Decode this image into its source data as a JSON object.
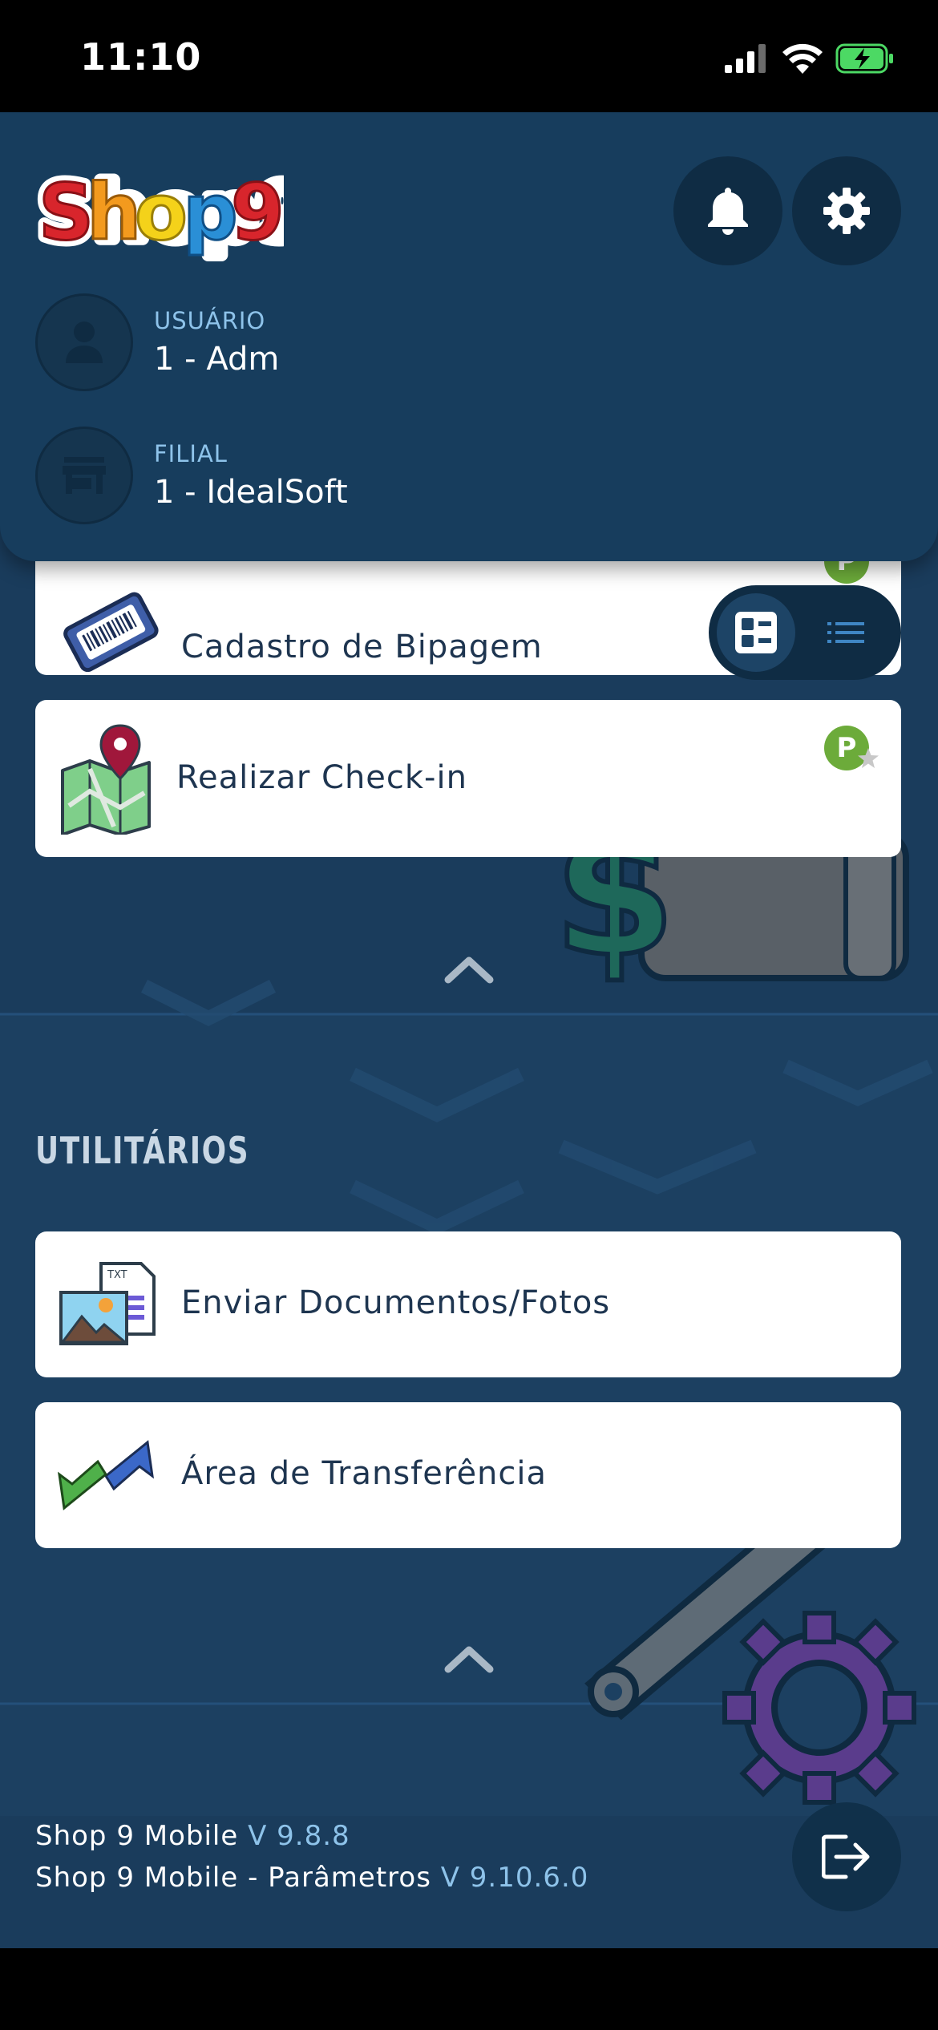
{
  "status_bar": {
    "time": "11:10"
  },
  "header": {
    "logo_text": "Shop9",
    "user": {
      "label": "USUÁRIO",
      "value": "1 - Adm"
    },
    "branch": {
      "label": "FILIAL",
      "value": "1 - IdealSoft"
    },
    "icons": [
      "bell-icon",
      "gear-icon",
      "person-icon",
      "store-icon"
    ]
  },
  "section_1": {
    "items": [
      {
        "label": "Cadastro de Bipagem",
        "icon": "barcode-ticket-icon",
        "badge": "P"
      },
      {
        "label": "Realizar Check-in",
        "icon": "map-pin-icon",
        "badge": "P"
      }
    ]
  },
  "view_toggle": {
    "options": [
      "grid-view",
      "list-view"
    ],
    "selected": "grid-view"
  },
  "section_2": {
    "title": "UTILITÁRIOS",
    "items": [
      {
        "label": "Enviar Documentos/Fotos",
        "icon": "documents-photos-icon"
      },
      {
        "label": "Área de Transferência",
        "icon": "transfer-arrows-icon"
      }
    ]
  },
  "footer": {
    "app_name": "Shop 9 Mobile",
    "app_version": "V 9.8.8",
    "params_name": "Shop 9 Mobile - Parâmetros",
    "params_version": "V 9.10.6.0"
  },
  "colors": {
    "background": "#1a3c5c",
    "header": "#173d5d",
    "accent_light": "#8ec3ea",
    "badge_green": "#6cab3a"
  }
}
